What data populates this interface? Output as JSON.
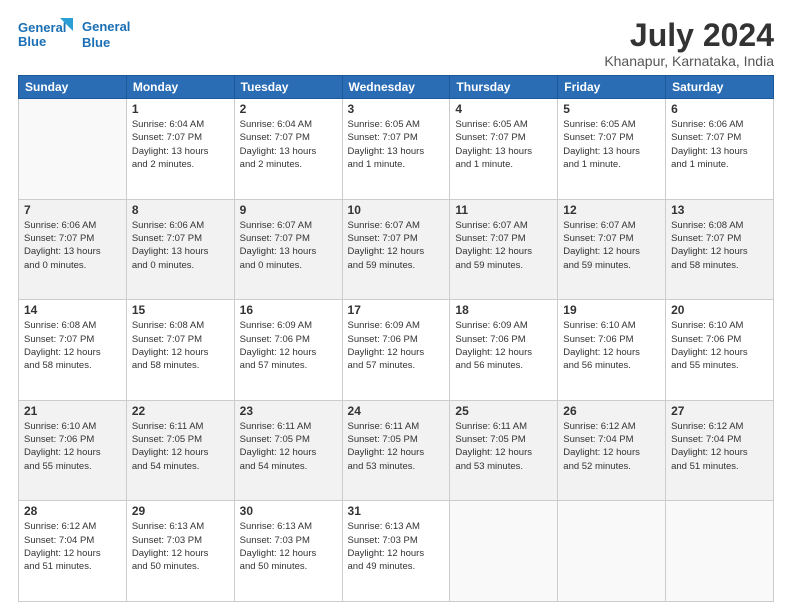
{
  "header": {
    "logo_line1": "General",
    "logo_line2": "Blue",
    "title": "July 2024",
    "subtitle": "Khanapur, Karnataka, India"
  },
  "weekdays": [
    "Sunday",
    "Monday",
    "Tuesday",
    "Wednesday",
    "Thursday",
    "Friday",
    "Saturday"
  ],
  "weeks": [
    [
      {
        "day": "",
        "info": ""
      },
      {
        "day": "1",
        "info": "Sunrise: 6:04 AM\nSunset: 7:07 PM\nDaylight: 13 hours\nand 2 minutes."
      },
      {
        "day": "2",
        "info": "Sunrise: 6:04 AM\nSunset: 7:07 PM\nDaylight: 13 hours\nand 2 minutes."
      },
      {
        "day": "3",
        "info": "Sunrise: 6:05 AM\nSunset: 7:07 PM\nDaylight: 13 hours\nand 1 minute."
      },
      {
        "day": "4",
        "info": "Sunrise: 6:05 AM\nSunset: 7:07 PM\nDaylight: 13 hours\nand 1 minute."
      },
      {
        "day": "5",
        "info": "Sunrise: 6:05 AM\nSunset: 7:07 PM\nDaylight: 13 hours\nand 1 minute."
      },
      {
        "day": "6",
        "info": "Sunrise: 6:06 AM\nSunset: 7:07 PM\nDaylight: 13 hours\nand 1 minute."
      }
    ],
    [
      {
        "day": "7",
        "info": "Sunrise: 6:06 AM\nSunset: 7:07 PM\nDaylight: 13 hours\nand 0 minutes."
      },
      {
        "day": "8",
        "info": "Sunrise: 6:06 AM\nSunset: 7:07 PM\nDaylight: 13 hours\nand 0 minutes."
      },
      {
        "day": "9",
        "info": "Sunrise: 6:07 AM\nSunset: 7:07 PM\nDaylight: 13 hours\nand 0 minutes."
      },
      {
        "day": "10",
        "info": "Sunrise: 6:07 AM\nSunset: 7:07 PM\nDaylight: 12 hours\nand 59 minutes."
      },
      {
        "day": "11",
        "info": "Sunrise: 6:07 AM\nSunset: 7:07 PM\nDaylight: 12 hours\nand 59 minutes."
      },
      {
        "day": "12",
        "info": "Sunrise: 6:07 AM\nSunset: 7:07 PM\nDaylight: 12 hours\nand 59 minutes."
      },
      {
        "day": "13",
        "info": "Sunrise: 6:08 AM\nSunset: 7:07 PM\nDaylight: 12 hours\nand 58 minutes."
      }
    ],
    [
      {
        "day": "14",
        "info": "Sunrise: 6:08 AM\nSunset: 7:07 PM\nDaylight: 12 hours\nand 58 minutes."
      },
      {
        "day": "15",
        "info": "Sunrise: 6:08 AM\nSunset: 7:07 PM\nDaylight: 12 hours\nand 58 minutes."
      },
      {
        "day": "16",
        "info": "Sunrise: 6:09 AM\nSunset: 7:06 PM\nDaylight: 12 hours\nand 57 minutes."
      },
      {
        "day": "17",
        "info": "Sunrise: 6:09 AM\nSunset: 7:06 PM\nDaylight: 12 hours\nand 57 minutes."
      },
      {
        "day": "18",
        "info": "Sunrise: 6:09 AM\nSunset: 7:06 PM\nDaylight: 12 hours\nand 56 minutes."
      },
      {
        "day": "19",
        "info": "Sunrise: 6:10 AM\nSunset: 7:06 PM\nDaylight: 12 hours\nand 56 minutes."
      },
      {
        "day": "20",
        "info": "Sunrise: 6:10 AM\nSunset: 7:06 PM\nDaylight: 12 hours\nand 55 minutes."
      }
    ],
    [
      {
        "day": "21",
        "info": "Sunrise: 6:10 AM\nSunset: 7:06 PM\nDaylight: 12 hours\nand 55 minutes."
      },
      {
        "day": "22",
        "info": "Sunrise: 6:11 AM\nSunset: 7:05 PM\nDaylight: 12 hours\nand 54 minutes."
      },
      {
        "day": "23",
        "info": "Sunrise: 6:11 AM\nSunset: 7:05 PM\nDaylight: 12 hours\nand 54 minutes."
      },
      {
        "day": "24",
        "info": "Sunrise: 6:11 AM\nSunset: 7:05 PM\nDaylight: 12 hours\nand 53 minutes."
      },
      {
        "day": "25",
        "info": "Sunrise: 6:11 AM\nSunset: 7:05 PM\nDaylight: 12 hours\nand 53 minutes."
      },
      {
        "day": "26",
        "info": "Sunrise: 6:12 AM\nSunset: 7:04 PM\nDaylight: 12 hours\nand 52 minutes."
      },
      {
        "day": "27",
        "info": "Sunrise: 6:12 AM\nSunset: 7:04 PM\nDaylight: 12 hours\nand 51 minutes."
      }
    ],
    [
      {
        "day": "28",
        "info": "Sunrise: 6:12 AM\nSunset: 7:04 PM\nDaylight: 12 hours\nand 51 minutes."
      },
      {
        "day": "29",
        "info": "Sunrise: 6:13 AM\nSunset: 7:03 PM\nDaylight: 12 hours\nand 50 minutes."
      },
      {
        "day": "30",
        "info": "Sunrise: 6:13 AM\nSunset: 7:03 PM\nDaylight: 12 hours\nand 50 minutes."
      },
      {
        "day": "31",
        "info": "Sunrise: 6:13 AM\nSunset: 7:03 PM\nDaylight: 12 hours\nand 49 minutes."
      },
      {
        "day": "",
        "info": ""
      },
      {
        "day": "",
        "info": ""
      },
      {
        "day": "",
        "info": ""
      }
    ]
  ]
}
